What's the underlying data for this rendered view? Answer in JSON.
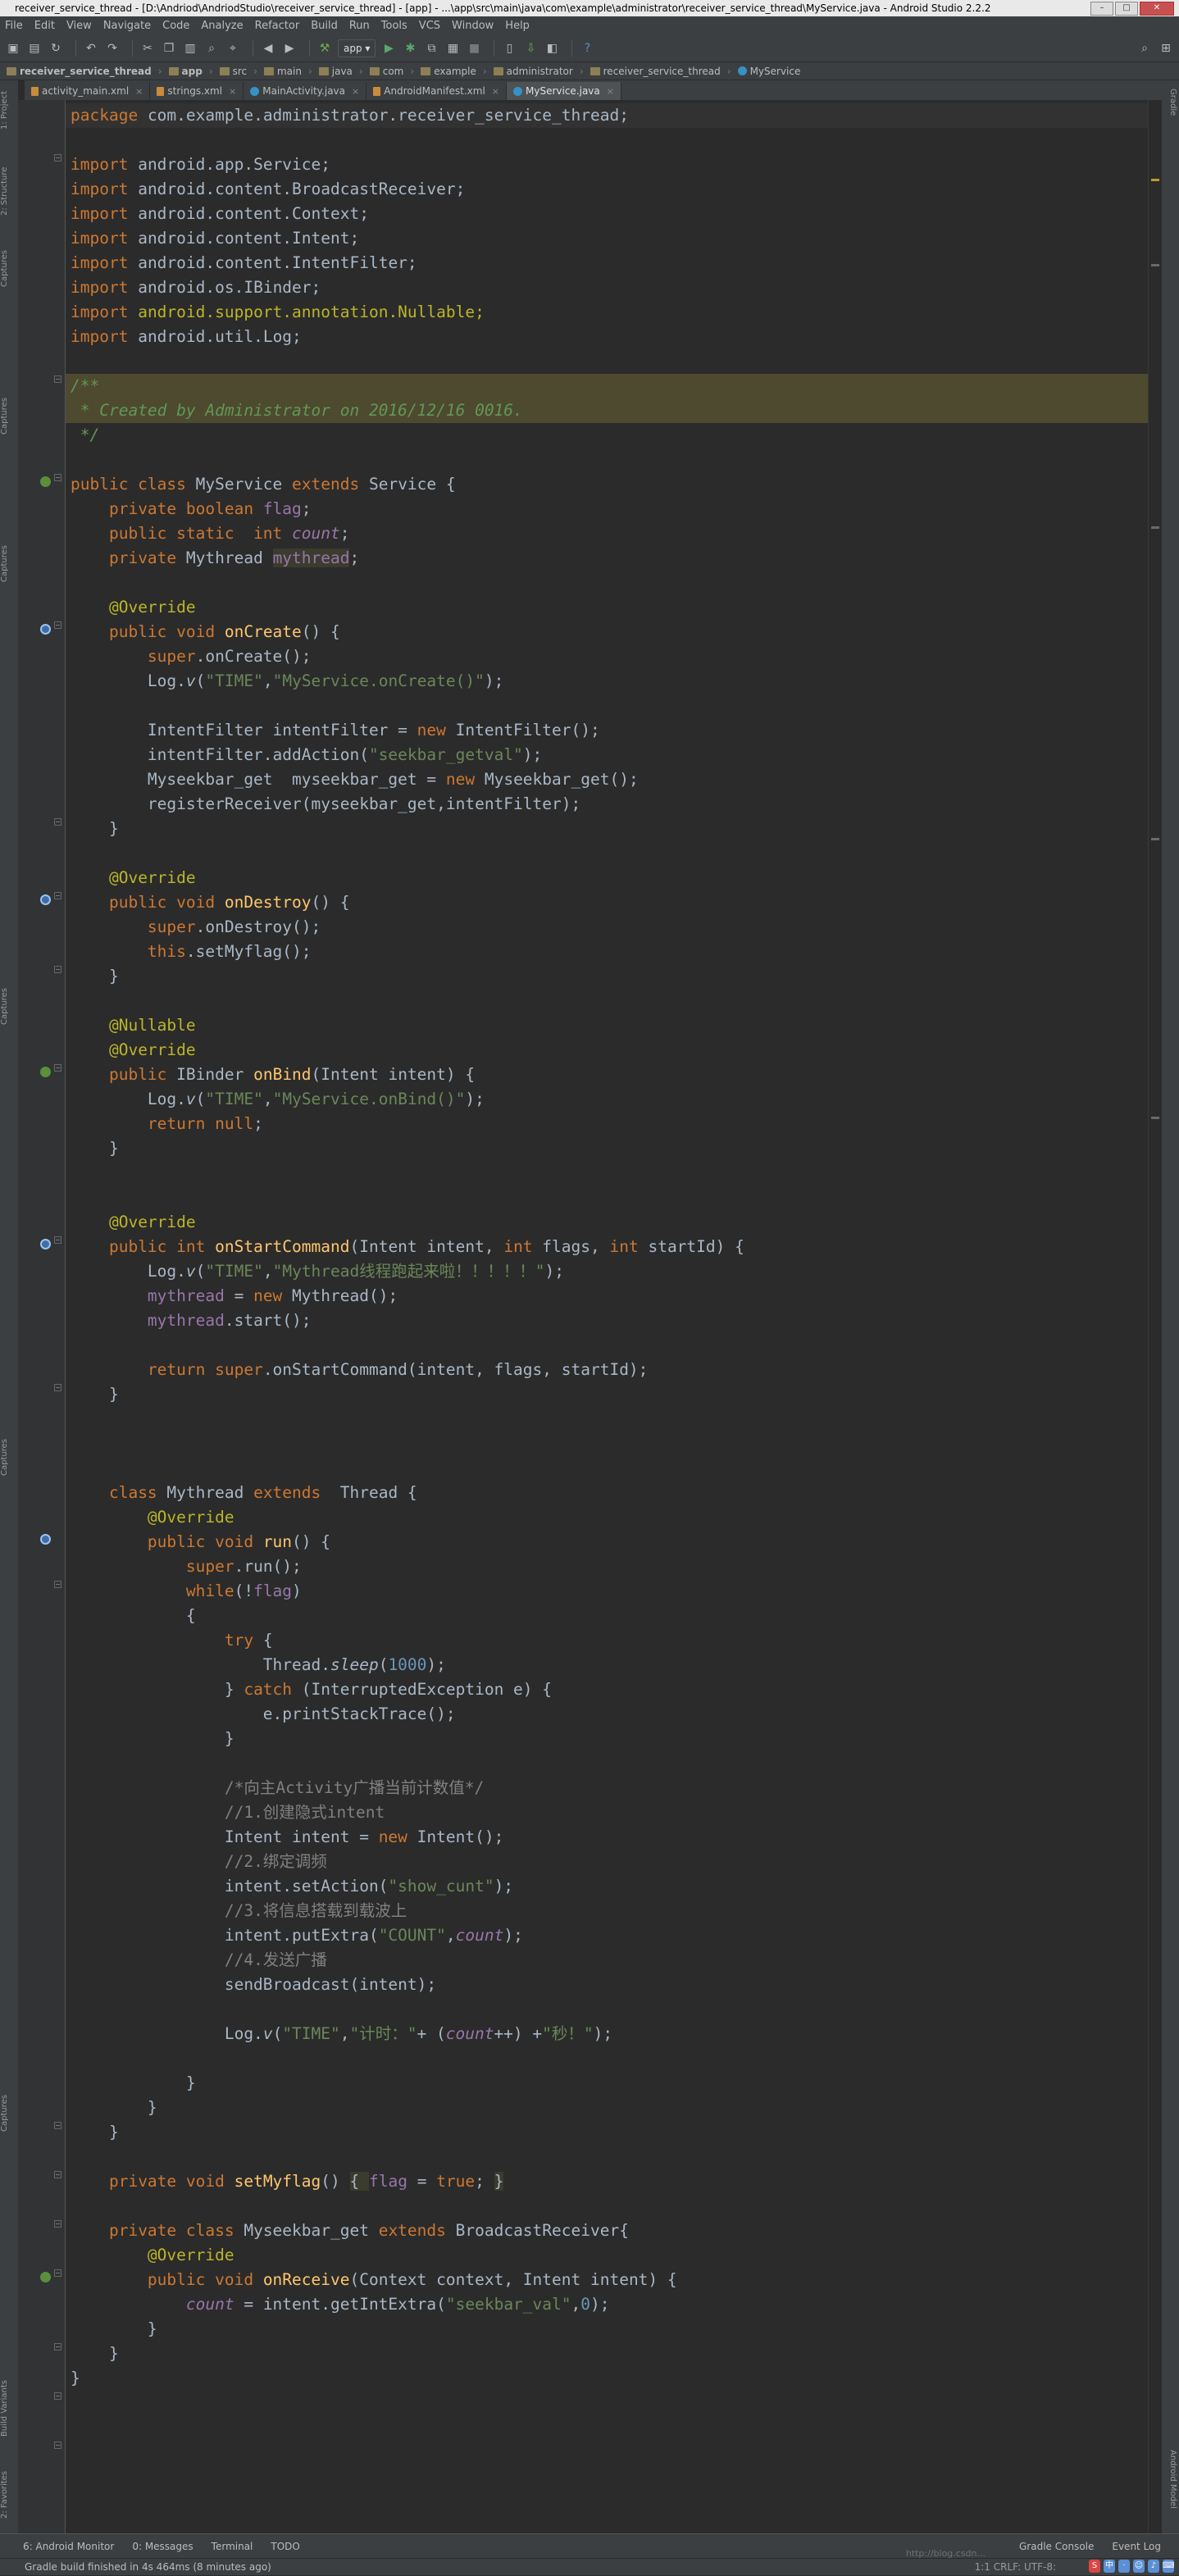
{
  "window": {
    "title": "receiver_service_thread - [D:\\Andriod\\AndriodStudio\\receiver_service_thread] - [app] - ...\\app\\src\\main\\java\\com\\example\\administrator\\receiver_service_thread\\MyService.java - Android Studio 2.2.2"
  },
  "menu": [
    "File",
    "Edit",
    "View",
    "Navigate",
    "Code",
    "Analyze",
    "Refactor",
    "Build",
    "Run",
    "Tools",
    "VCS",
    "Window",
    "Help"
  ],
  "toolbar": {
    "run_config": "app"
  },
  "breadcrumbs": [
    "receiver_service_thread",
    "app",
    "src",
    "main",
    "java",
    "com",
    "example",
    "administrator",
    "receiver_service_thread",
    "MyService"
  ],
  "tabs": [
    {
      "label": "activity_main.xml"
    },
    {
      "label": "strings.xml"
    },
    {
      "label": "MainActivity.java"
    },
    {
      "label": "AndroidManifest.xml"
    },
    {
      "label": "MyService.java",
      "active": true
    }
  ],
  "left_tools": [
    "1: Project",
    "2: Structure",
    "Captures",
    "Captures",
    "Captures",
    "Captures",
    "Captures",
    "Captures",
    "Build Variants",
    "2: Favorites"
  ],
  "right_tools": [
    "Gradle",
    "Android Model"
  ],
  "bottom_tools": [
    "6: Android Monitor",
    "0: Messages",
    "Terminal",
    "TODO"
  ],
  "bottom_right_tools": [
    "Gradle Console",
    "Event Log"
  ],
  "status": {
    "message": "Gradle build finished in 4s 464ms (8 minutes ago)",
    "position": "1:1  CRLF:  UTF-8:"
  },
  "watermark": "http://blog.csdn...",
  "colors": {
    "keyword": "#cc7832",
    "string": "#6a8759",
    "number": "#6897bb",
    "annotation": "#bbb529",
    "method": "#ffc66d",
    "field": "#9876aa",
    "comment": "#808080"
  },
  "code": {
    "package_path": "com.example.administrator.receiver_service_thread;",
    "imports": [
      "android.app.Service;",
      "android.content.BroadcastReceiver;",
      "android.content.Context;",
      "android.content.Intent;",
      "android.content.IntentFilter;",
      "android.os.IBinder;",
      "android.support.annotation.Nullable;",
      "android.util.Log;"
    ],
    "doc_comment": " * Created by Administrator on 2016/12/16 0016.",
    "class_name": "MyService",
    "log_tag": "\"TIME\"",
    "on_create_log": "\"MyService.onCreate()\"",
    "filter_action": "\"seekbar_getval\"",
    "on_bind_log": "\"MyService.onBind()\"",
    "start_log": "\"Mythread线程跑起来啦！！！！！\"",
    "sleep_ms": "1000",
    "comment_broadcast": "/*向主Activity广播当前计数值*/",
    "comment_1": "//1.创建隐式intent",
    "comment_2": "//2.绑定调频",
    "action_name": "\"show_cunt\"",
    "comment_3": "//3.将信息搭载到载波上",
    "extra_key": "\"COUNT\"",
    "comment_4": "//4.发送广播",
    "count_prefix": "\"计时：\"",
    "count_suffix": "\"秒！\"",
    "receive_key": "\"seekbar_val\"",
    "receive_default": "0"
  }
}
